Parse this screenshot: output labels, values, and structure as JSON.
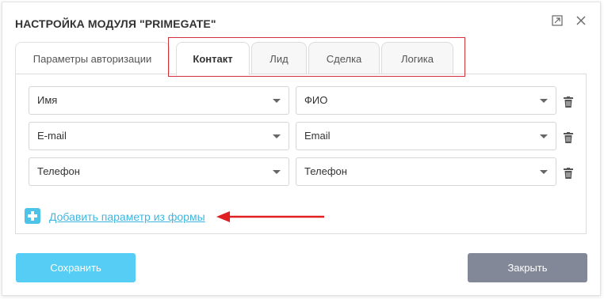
{
  "dialog": {
    "title": "НАСТРОЙКА МОДУЛЯ \"PRIMEGATE\"",
    "expand_icon": "expand-icon",
    "close_icon": "close-icon"
  },
  "tabs": [
    {
      "label": "Параметры авторизации",
      "active": false
    },
    {
      "label": "Контакт",
      "active": true
    },
    {
      "label": "Лид",
      "active": false
    },
    {
      "label": "Сделка",
      "active": false
    },
    {
      "label": "Логика",
      "active": false
    }
  ],
  "mappings": [
    {
      "form_field": "Имя",
      "crm_field": "ФИО"
    },
    {
      "form_field": "E-mail",
      "crm_field": "Email"
    },
    {
      "form_field": "Телефон",
      "crm_field": "Телефон"
    }
  ],
  "add_param": {
    "label": "Добавить параметр из формы",
    "icon": "plus-icon"
  },
  "buttons": {
    "save": "Сохранить",
    "close": "Закрыть"
  },
  "colors": {
    "accent": "#55cdf5",
    "link": "#3fb7e0",
    "close_button": "#828898",
    "highlight": "#d0313d",
    "annotation_arrow": "#e02020"
  }
}
